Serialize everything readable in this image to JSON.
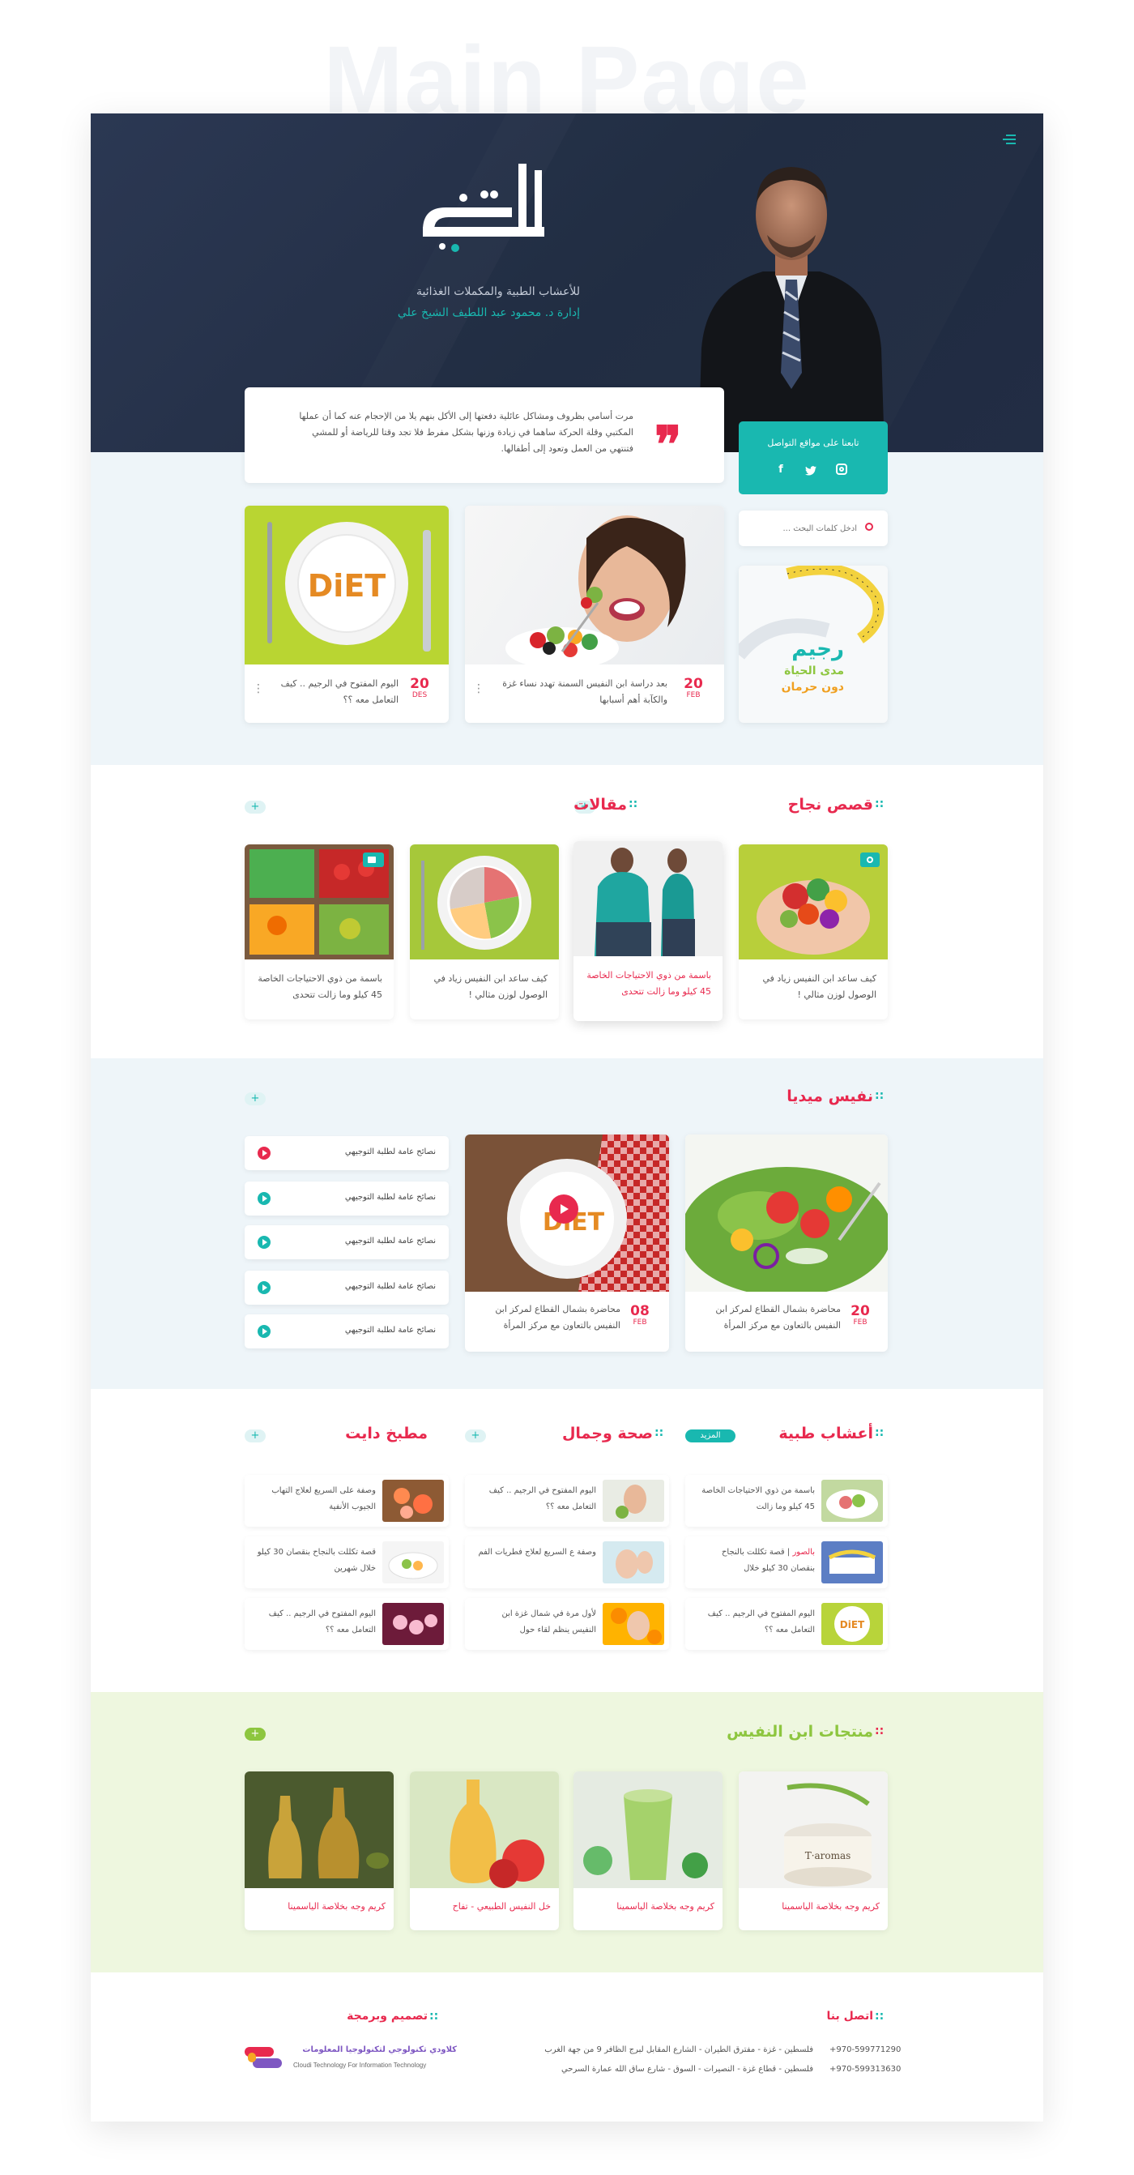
{
  "page_title_watermark": "Main Page",
  "colors": {
    "accent_red": "#e8294e",
    "accent_teal": "#19b8b0",
    "accent_green": "#8dc63f",
    "hero_navy": "#222d44"
  },
  "hero": {
    "logo_text": "النفيس",
    "subtitle": "للأعشاب الطبية والمكملات الغذائية",
    "manager": "إدارة د. محمود عبد اللطيف الشيخ علي",
    "menu_icon": "hamburger-icon"
  },
  "quote": {
    "text": "مرت أسامي بظروف ومشاكل عائلية دفعتها إلى الأكل بنهم يلا من الإحجام عنه كما أن عملها المكتبي وقلة الحركة ساهما في زيادة وزنها بشكل مفرط فلا تجد وقتا للرياضة أو للمشي فتنتهي من العمل وتعود إلى أطفالها."
  },
  "social": {
    "label": "تابعنا على مواقع التواصل",
    "icons": [
      "facebook-icon",
      "twitter-icon",
      "instagram-icon"
    ]
  },
  "search": {
    "placeholder": "ادخل كلمات البحث ..."
  },
  "promo": {
    "line1": "رجيم",
    "line2": "مدى الحياة",
    "line3": "دون حرمان"
  },
  "top_posts": [
    {
      "text": "بعد دراسة ابن النفيس السمنة تهدد نساء غزة والكآبة أهم أسبابها",
      "day": "20",
      "month": "FEB"
    },
    {
      "text": "اليوم المفتوح في الرجيم .. كيف التعامل معه ؟؟",
      "day": "20",
      "month": "DES"
    }
  ],
  "success": {
    "title": "قصص نجاح",
    "items": [
      "كيف ساعد ابن النفيس زياد في الوصول لوزن مثالي !",
      "باسمة من ذوي الاحتياجات الخاصة 45 كيلو وما زالت تتحدى"
    ]
  },
  "articles": {
    "title": "مقالات",
    "items": [
      "كيف ساعد ابن النفيس زياد في الوصول لوزن مثالي !",
      "باسمة من ذوي الاحتياجات الخاصة 45 كيلو وما زالت تتحدى"
    ]
  },
  "media": {
    "title": "نفيس ميديا",
    "cards": [
      {
        "text": "محاضرة بشمال القطاع لمركز ابن النفيس بالتعاون مع مركز المرأة",
        "day": "20",
        "month": "FEB"
      },
      {
        "text": "محاضرة بشمال القطاع لمركز ابن النفيس بالتعاون مع مركز المرأة",
        "day": "08",
        "month": "FEB"
      }
    ],
    "list": [
      "نصائح عامة لطلبة التوجيهي",
      "نصائح عامة لطلبة التوجيهي",
      "نصائح عامة لطلبة التوجيهي",
      "نصائح عامة لطلبة التوجيهي",
      "نصائح عامة لطلبة التوجيهي"
    ]
  },
  "herbs": {
    "title": "أعشاب طبية",
    "more": "المزيد",
    "items": [
      {
        "highlight": "",
        "text": "باسمة من ذوي الاحتياجات الخاصة 45 كيلو وما زالت"
      },
      {
        "highlight": "بالصور",
        "text": "| قصة تكللت بالنجاح بنقصان 30 كيلو خلال"
      },
      {
        "highlight": "",
        "text": "اليوم المفتوح في الرجيم .. كيف التعامل معه ؟؟"
      }
    ]
  },
  "health": {
    "title": "صحة وجمال",
    "items": [
      "اليوم المفتوح في الرجيم .. كيف التعامل معه ؟؟",
      "وصفة ع السريع لعلاج فطريات الفم",
      "لأول مرة في شمال غزة ابن النفيس ينظم لقاء حول"
    ]
  },
  "kitchen": {
    "title": "مطبخ دايت",
    "items": [
      "وصفة على السريع لعلاج التهاب الجيوب الأنفية",
      "قصة تكللت بالنجاح بنقصان 30 كيلو خلال شهرين",
      "اليوم المفتوح في الرجيم .. كيف التعامل معه ؟؟"
    ]
  },
  "products": {
    "title": "منتجات ابن النفيس",
    "items": [
      "كريم وجه بخلاصة الياسمينا",
      "كريم وجه بخلاصة الياسمينا",
      "خل النفيس الطبيعي - تفاح",
      "كريم وجه بخلاصة الياسمينا"
    ]
  },
  "footer": {
    "contact_title": "اتصل بنا",
    "phone1": "+970-599771290",
    "phone2": "+970-599313630",
    "address1": "فلسطين - غزة - مفترق الطيران - الشارع المقابل لبرج الظافر 9 من جهة الغرب",
    "address2": "فلسطين - قطاع غزة - النصيرات - السوق - شارع ساق الله عمارة السرحي",
    "design_title": "تصميم وبرمجة",
    "company_ar": "كلاودي تكنولوجي لتكنولوجيا المعلومات",
    "company_en": "Cloudi Technology For Information Technology"
  }
}
